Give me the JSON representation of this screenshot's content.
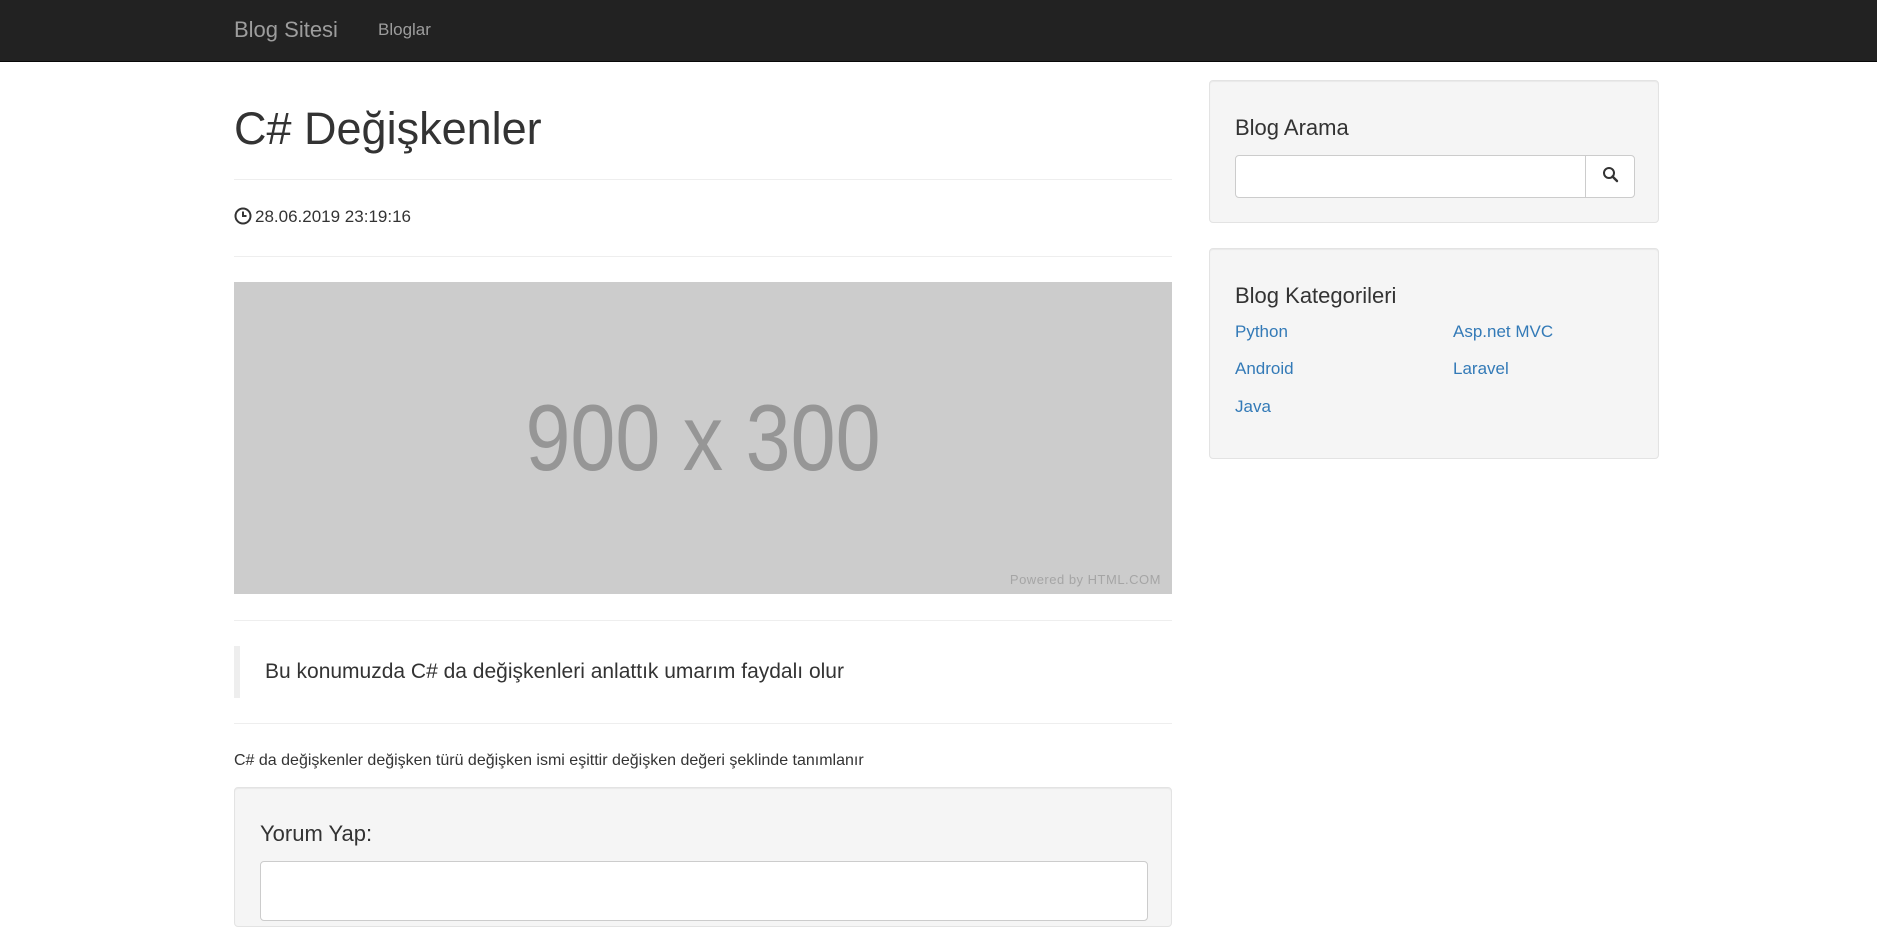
{
  "navbar": {
    "brand": "Blog Sitesi",
    "link": "Bloglar"
  },
  "post": {
    "title": "C# Değişkenler",
    "date": "28.06.2019 23:19:16",
    "image": {
      "size_label": "900 x 300",
      "powered_label": "Powered by HTML.COM"
    },
    "lead": "Bu konumuzda C# da değişkenleri anlattık umarım faydalı olur",
    "body": "C# da değişkenler değişken türü değişken ismi eşittir değişken değeri şeklinde tanımlanır"
  },
  "comment": {
    "title": "Yorum Yap:",
    "value": ""
  },
  "sidebar": {
    "search": {
      "title": "Blog Arama",
      "value": ""
    },
    "categories": {
      "title": "Blog Kategorileri",
      "items": [
        "Python",
        "Asp.net MVC",
        "Android",
        "Laravel",
        "Java"
      ]
    }
  },
  "colors": {
    "navbar": "#222222",
    "link": "#337ab7",
    "well": "#f5f5f5"
  },
  "icons": {
    "date": "clock-icon",
    "search": "search-icon"
  }
}
